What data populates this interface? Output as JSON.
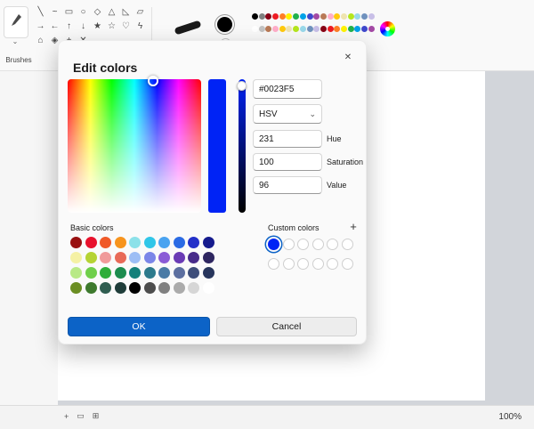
{
  "colors": {
    "accent": "#0C63C7",
    "current": "#0023F5"
  },
  "toolbar": {
    "brushes_group": {
      "label": "Brushes",
      "chevron": "⌄"
    },
    "shape_glyphs": [
      "╲",
      "~",
      "▭",
      "○",
      "◇",
      "△",
      "◺",
      "▱",
      "→",
      "←",
      "↑",
      "↓",
      "★",
      "☆",
      "♡",
      "ϟ",
      "⌂",
      "◈",
      "+",
      "✕"
    ],
    "color1": "#000000",
    "color2": "#FFFFFF",
    "palette": [
      "#000000",
      "#7F7F7F",
      "#880015",
      "#ED1C24",
      "#FF7F27",
      "#FFF200",
      "#22B14C",
      "#00A2E8",
      "#3F48CC",
      "#A349A4",
      "#B97A57",
      "#FFAEC9",
      "#FFC90E",
      "#EFE4B0",
      "#B5E61D",
      "#99D9EA",
      "#7092BE",
      "#C8BFE7",
      "#FFFFFF",
      "#C3C3C3",
      "#B97A57",
      "#FFAEC9",
      "#FFC90E",
      "#EFE4B0",
      "#B5E61D",
      "#99D9EA",
      "#7092BE",
      "#C8BFE7",
      "#880015",
      "#ED1C24",
      "#FF7F27",
      "#FFF200",
      "#22B14C",
      "#00A2E8",
      "#3F48CC",
      "#A349A4"
    ]
  },
  "dialog": {
    "title": "Edit colors",
    "close_glyph": "✕",
    "hex_value": "#0023F5",
    "color_model": "HSV",
    "model_chevron": "⌄",
    "fields": {
      "hue": {
        "value": "231",
        "label": "Hue"
      },
      "saturation": {
        "value": "100",
        "label": "Saturation"
      },
      "value": {
        "value": "96",
        "label": "Value"
      }
    },
    "basic_colors_label": "Basic colors",
    "custom_colors_label": "Custom colors",
    "add_custom_glyph": "+",
    "basic_colors": [
      "#991111",
      "#E8112D",
      "#F05A28",
      "#F7941D",
      "#8CE1E9",
      "#30C6E8",
      "#4AA3F0",
      "#2B6BE4",
      "#2330C9",
      "#151B8D",
      "#F5F1A4",
      "#B5D334",
      "#F09A9A",
      "#E86A58",
      "#9DBEF5",
      "#7B86E8",
      "#8A5BD6",
      "#6A3BB5",
      "#472B8A",
      "#2E2660",
      "#B8E986",
      "#6FCF4B",
      "#2EAD3A",
      "#1C8C4E",
      "#14807A",
      "#2C7A8C",
      "#4A7BA6",
      "#5C6FA0",
      "#3E4E7A",
      "#27355C",
      "#6B8E23",
      "#3E7A2E",
      "#2F5D50",
      "#1F3D3A",
      "#000000",
      "#4D4D4D",
      "#808080",
      "#ABABAB",
      "#D6D6D6",
      "#FFFFFF"
    ],
    "custom_colors": [
      "#0023F5"
    ],
    "ok_label": "OK",
    "cancel_label": "Cancel"
  },
  "statusbar": {
    "icon_glyphs": [
      "+",
      "▭",
      "⊞"
    ],
    "zoom": "100%"
  }
}
